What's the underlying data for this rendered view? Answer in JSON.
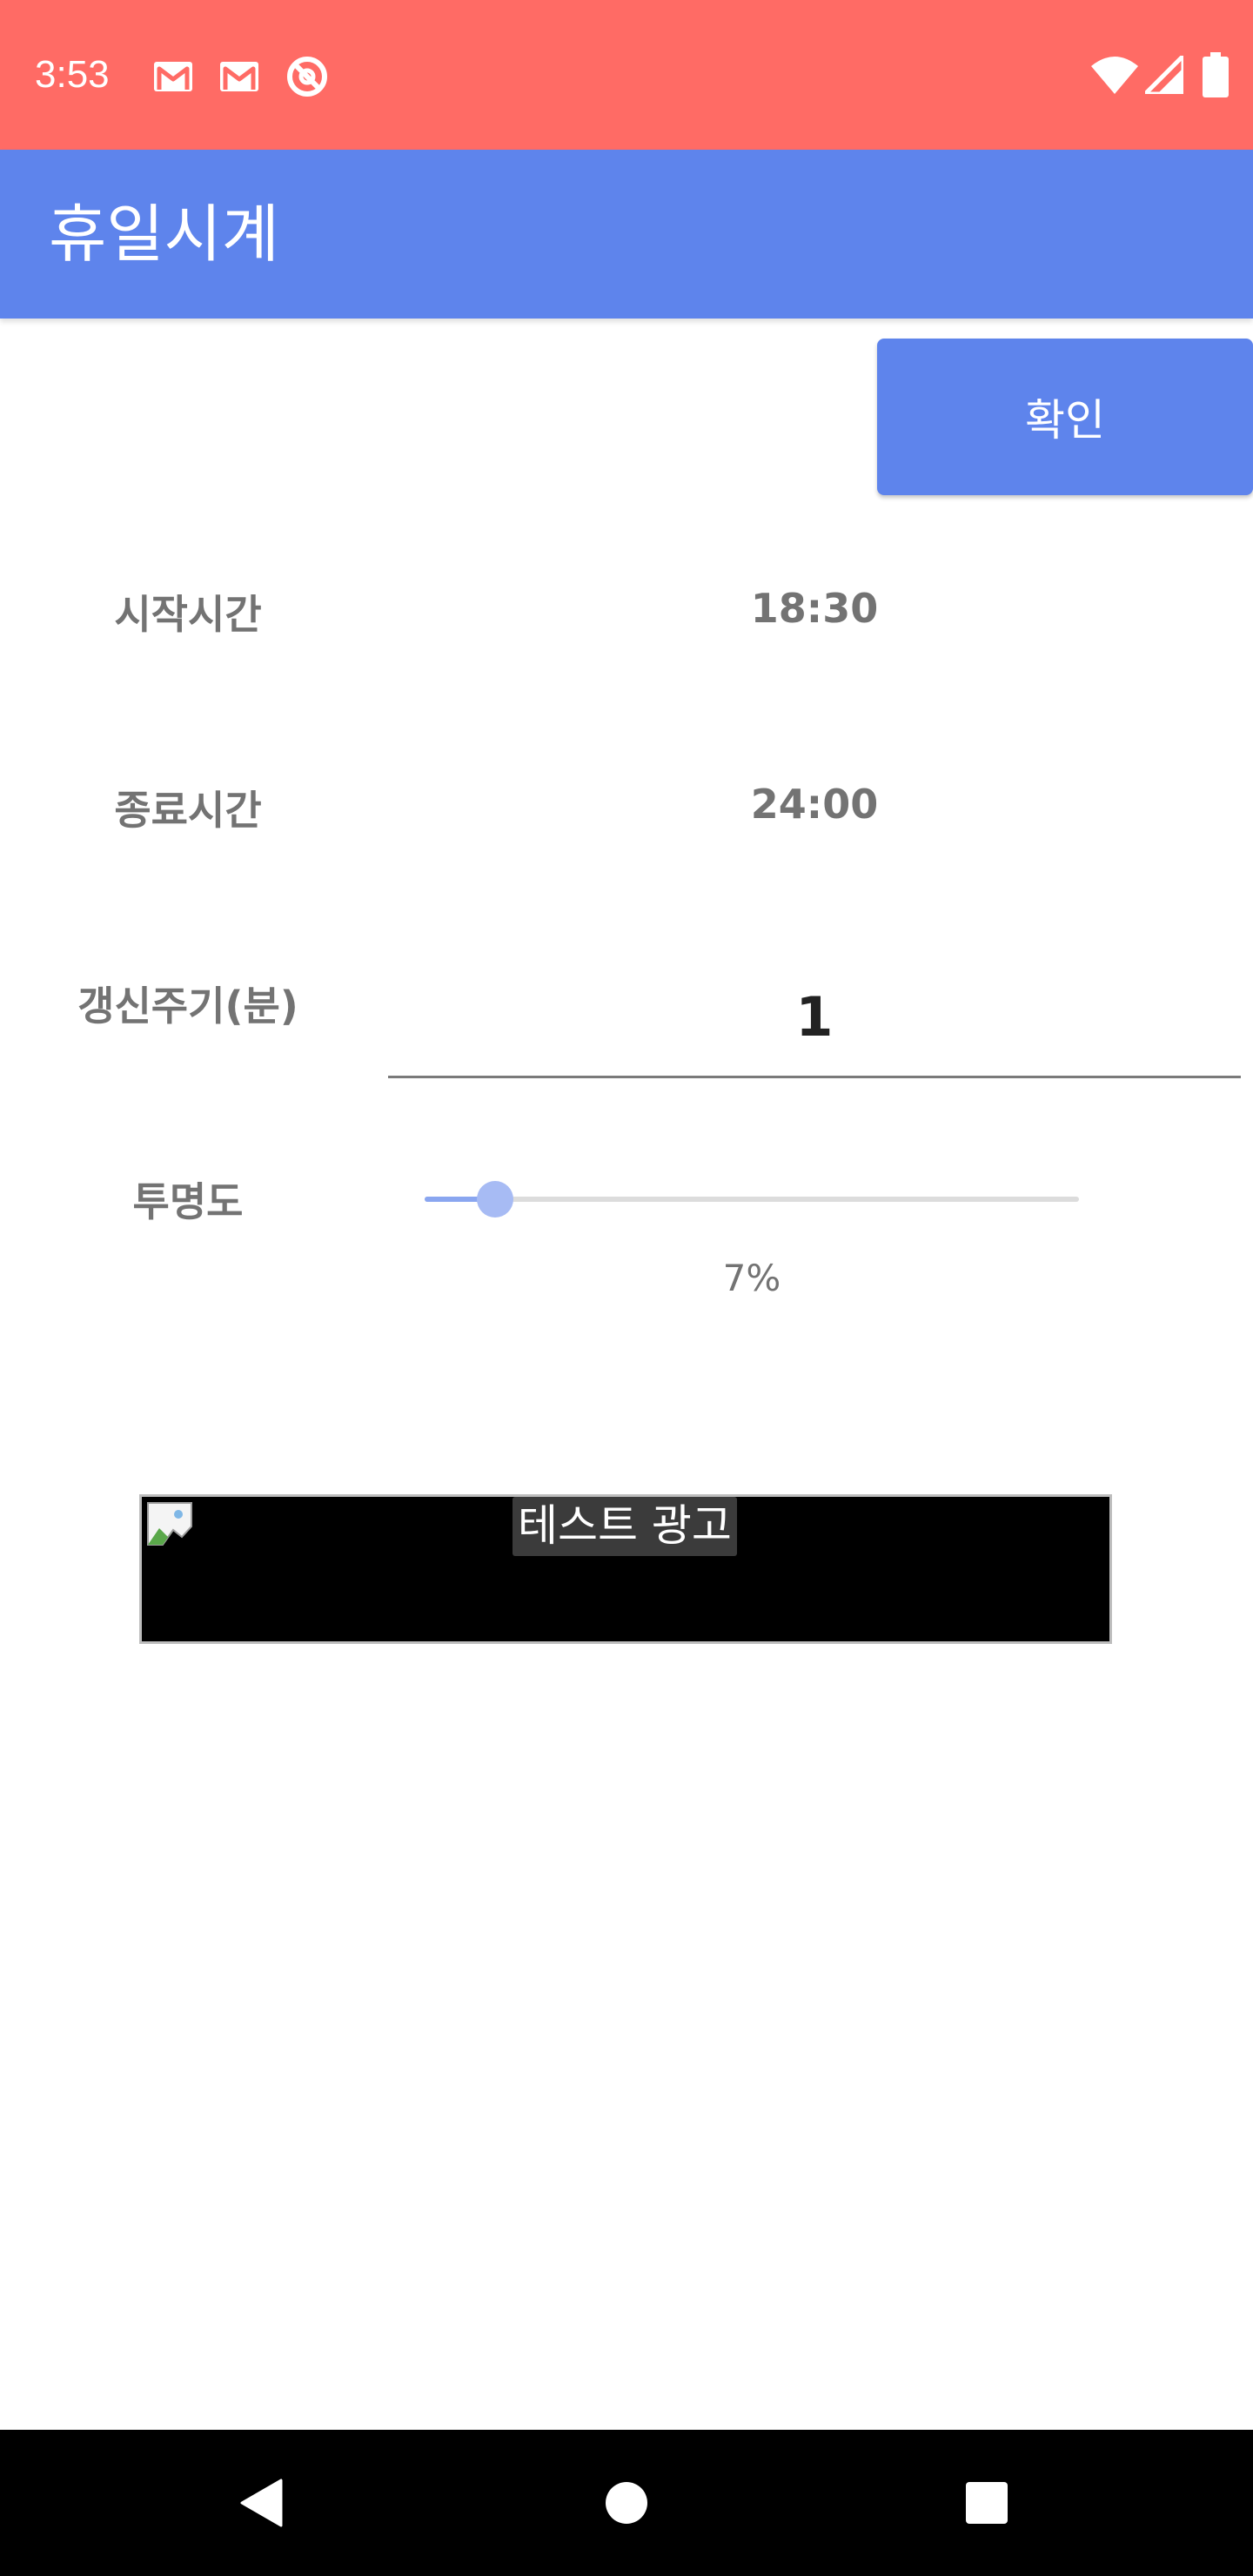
{
  "status_bar": {
    "time": "3:53",
    "left_icons": [
      "gmail-icon",
      "gmail-icon",
      "do-not-disturb-icon"
    ],
    "right_icons": [
      "wifi-icon",
      "signal-icon",
      "battery-icon"
    ],
    "color": "#ff6b65"
  },
  "app_bar": {
    "title": "휴일시계",
    "color": "#5e84ec"
  },
  "toolbar": {
    "confirm_label": "확인"
  },
  "settings": {
    "start": {
      "label": "시작시간",
      "value": "18:30"
    },
    "end": {
      "label": "종료시간",
      "value": "24:00"
    },
    "period": {
      "label": "갱신주기(분)",
      "value": "1"
    },
    "opacity": {
      "label": "투명도",
      "value": 0.07,
      "display": "7%"
    }
  },
  "ad": {
    "label": "테스트 광고"
  },
  "nav_bar": {
    "buttons": [
      "back-icon",
      "home-icon",
      "recents-icon"
    ]
  }
}
